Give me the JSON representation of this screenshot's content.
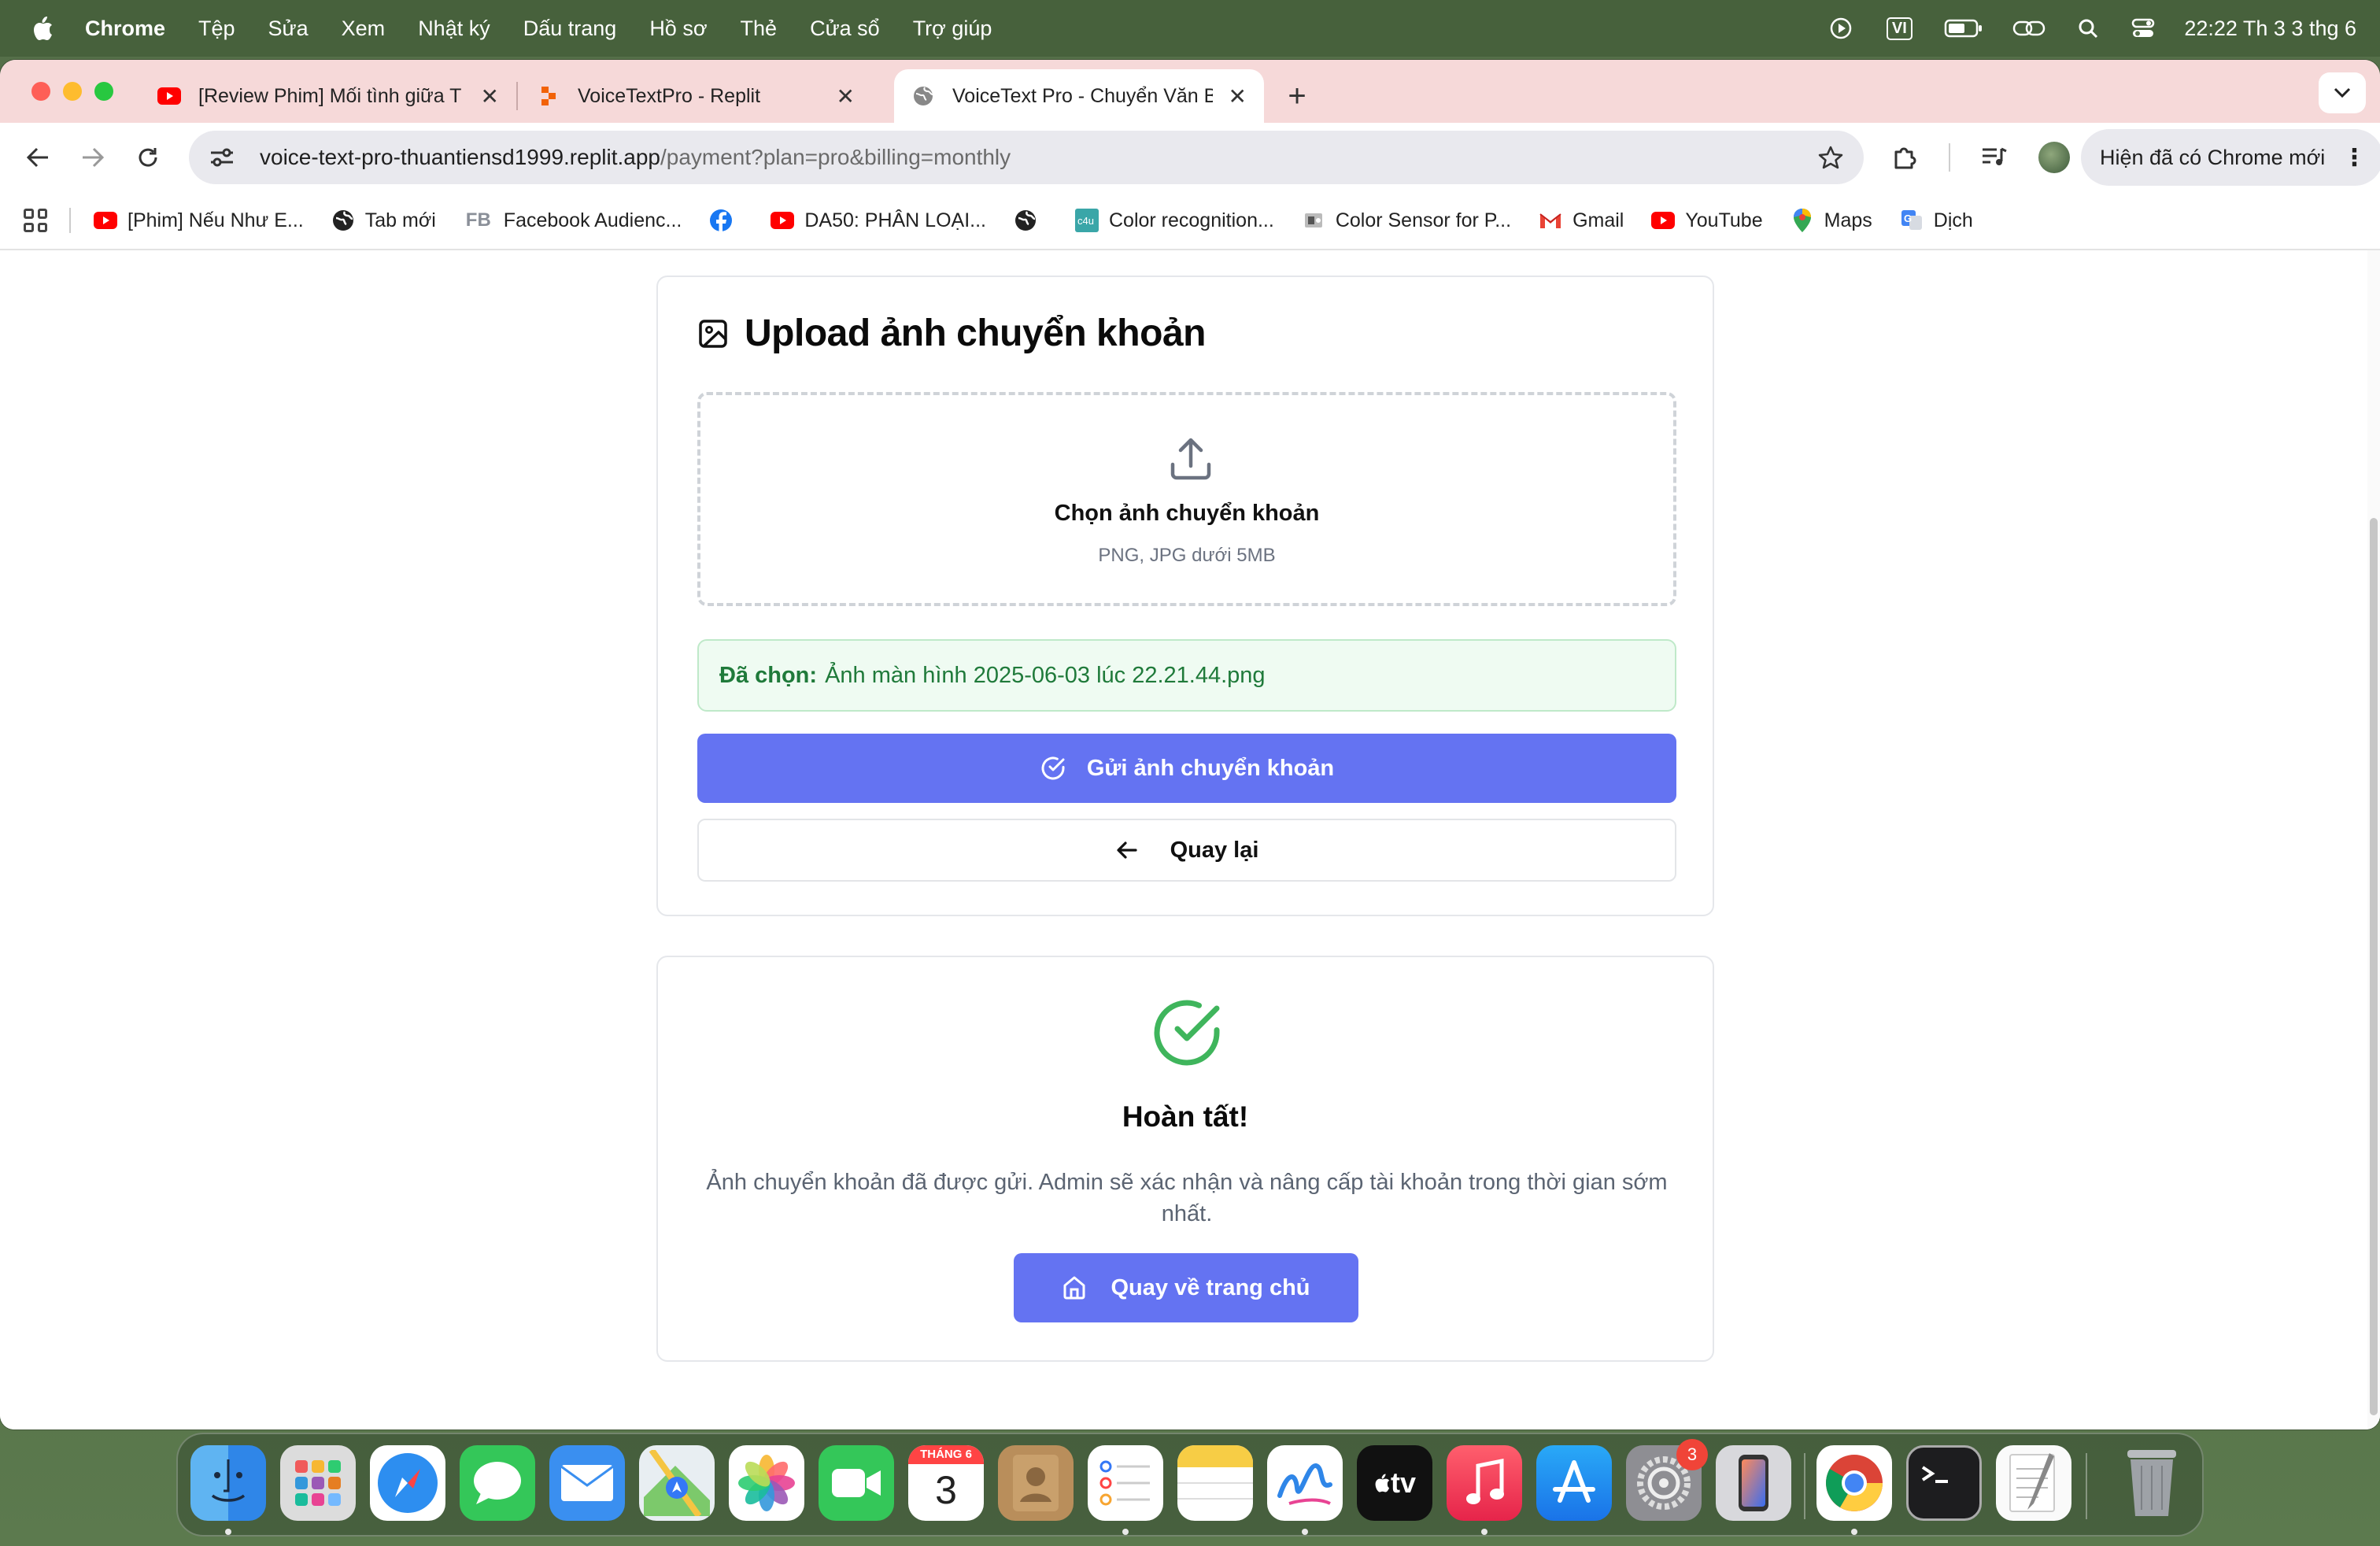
{
  "menubar": {
    "app": "Chrome",
    "items": [
      "Tệp",
      "Sửa",
      "Xem",
      "Nhật ký",
      "Dấu trang",
      "Hồ sơ",
      "Thẻ",
      "Cửa sổ",
      "Trợ giúp"
    ],
    "input_source": "VI",
    "clock": "22:22 Th 3 3 thg 6"
  },
  "tabs": [
    {
      "title": "[Review Phim] Mối tình giữa T",
      "icon": "youtube-icon"
    },
    {
      "title": "VoiceTextPro - Replit",
      "icon": "replit-icon"
    },
    {
      "title": "VoiceText Pro - Chuyển Văn B",
      "icon": "globe-icon",
      "active": true
    }
  ],
  "toolbar": {
    "url_host": "voice-text-pro-thuantiensd1999.replit.app",
    "url_path": "/payment?plan=pro&billing=monthly",
    "update_pill": "Hiện đã có Chrome mới"
  },
  "bookmarks": [
    {
      "label": "[Phim] Nếu Như E...",
      "icon": "youtube-icon"
    },
    {
      "label": "Tab mới",
      "icon": "globe-icon"
    },
    {
      "label": "Facebook Audienc...",
      "icon": "fb-text-icon"
    },
    {
      "label": "",
      "icon": "facebook-icon"
    },
    {
      "label": "DA50: PHÂN LOẠI...",
      "icon": "youtube-icon"
    },
    {
      "label": "",
      "icon": "globe-icon"
    },
    {
      "label": "Color recognition...",
      "icon": "c4u-icon"
    },
    {
      "label": "Color Sensor for P...",
      "icon": "sensor-icon"
    },
    {
      "label": "Gmail",
      "icon": "gmail-icon"
    },
    {
      "label": "YouTube",
      "icon": "youtube-icon"
    },
    {
      "label": "Maps",
      "icon": "maps-icon"
    },
    {
      "label": "Dịch",
      "icon": "translate-icon"
    }
  ],
  "upload": {
    "title": "Upload ảnh chuyển khoản",
    "dropzone_title": "Chọn ảnh chuyển khoản",
    "dropzone_hint": "PNG, JPG dưới 5MB",
    "selected_label": "Đã chọn:",
    "selected_file": "Ảnh màn hình 2025-06-03 lúc 22.21.44.png",
    "submit_label": "Gửi ảnh chuyển khoản",
    "back_label": "Quay lại"
  },
  "done": {
    "title": "Hoàn tất!",
    "message": "Ảnh chuyển khoản đã được gửi. Admin sẽ xác nhận và nâng cấp tài khoản trong thời gian sớm nhất.",
    "home_label": "Quay về trang chủ"
  },
  "dock": {
    "apps": [
      "finder-icon",
      "launchpad-icon",
      "safari-icon",
      "messages-icon",
      "mail-icon",
      "maps-icon",
      "photos-icon",
      "facetime-icon",
      "calendar-icon",
      "contacts-icon",
      "reminders-icon",
      "notes-icon",
      "freeform-icon",
      "appletv-icon",
      "music-icon",
      "appstore-icon",
      "settings-icon",
      "iphone-mirroring-icon",
      "chrome-icon",
      "terminal-icon",
      "textedit-icon",
      "trash-icon"
    ],
    "calendar_month": "THÁNG 6",
    "calendar_day": "3",
    "settings_badge": "3",
    "tv_label": "tv"
  }
}
